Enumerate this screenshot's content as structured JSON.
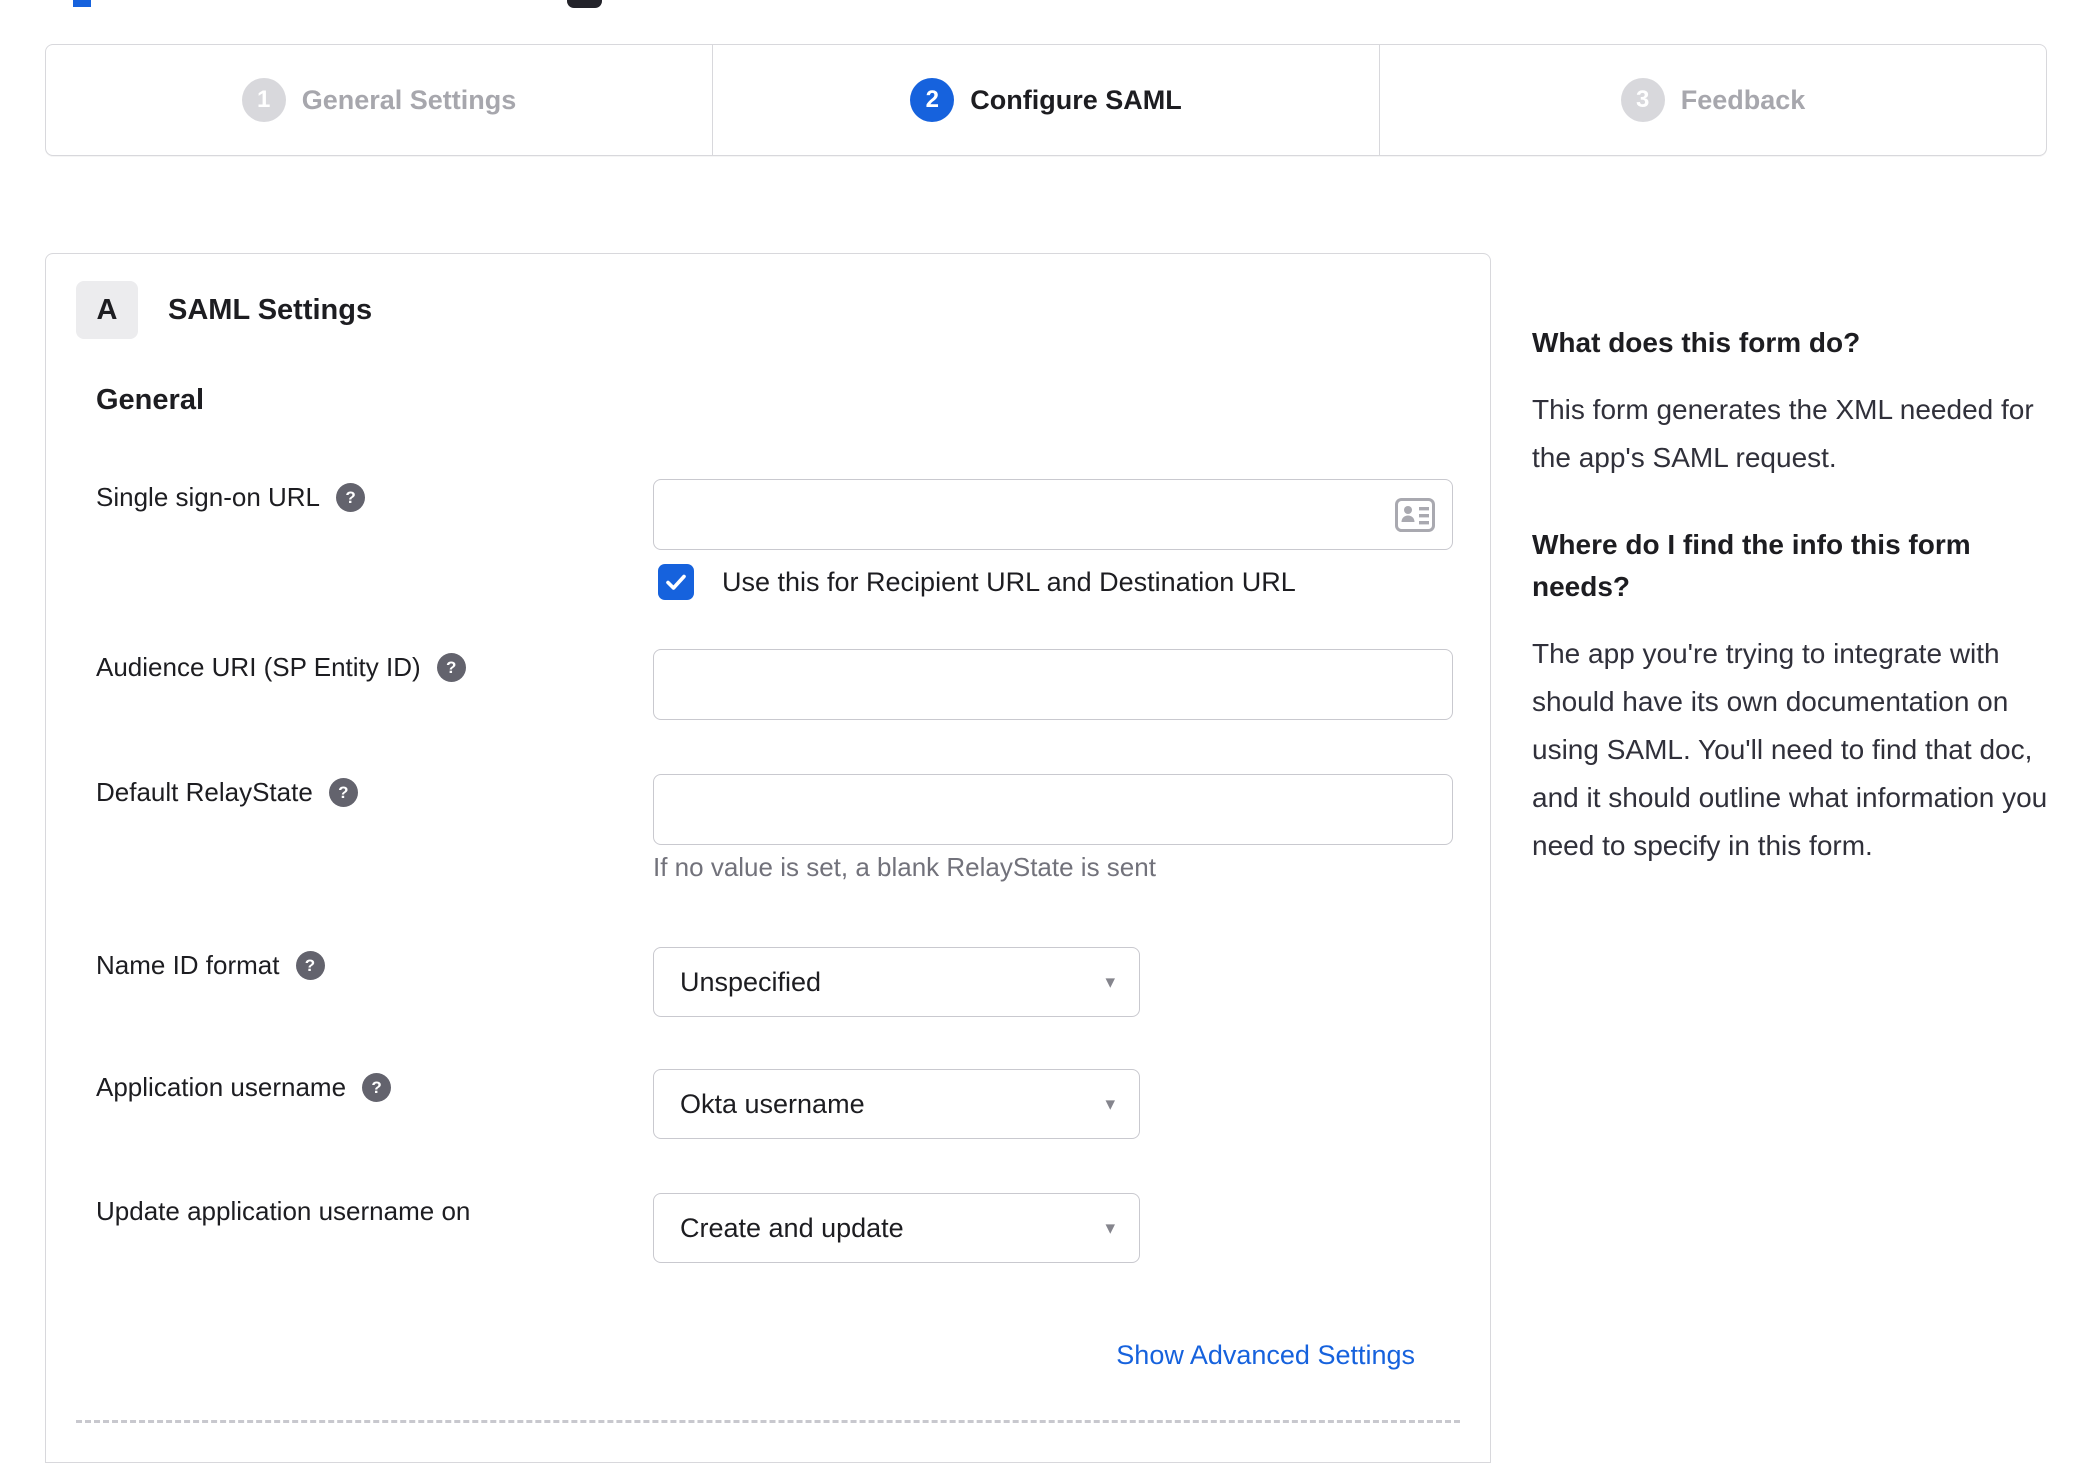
{
  "colors": {
    "accent_blue": "#1662dd",
    "inactive_gray": "#d8d8dc",
    "border": "#d8d8dc"
  },
  "header_fragments": {
    "blue_logo_fragment": "",
    "dark_control_fragment": ""
  },
  "stepper": {
    "steps": [
      {
        "number": "1",
        "label": "General Settings",
        "state": "inactive"
      },
      {
        "number": "2",
        "label": "Configure SAML",
        "state": "active"
      },
      {
        "number": "3",
        "label": "Feedback",
        "state": "inactive"
      }
    ]
  },
  "panel": {
    "section_letter": "A",
    "section_title": "SAML Settings",
    "group_title": "General",
    "help_icon_glyph": "?",
    "fields": {
      "sso": {
        "label": "Single sign-on URL",
        "value": "",
        "checkbox_checked": true,
        "checkbox_label": "Use this for Recipient URL and Destination URL"
      },
      "audience": {
        "label": "Audience URI (SP Entity ID)",
        "value": ""
      },
      "relay": {
        "label": "Default RelayState",
        "value": "",
        "hint": "If no value is set, a blank RelayState is sent"
      },
      "nameid": {
        "label": "Name ID format",
        "value": "Unspecified"
      },
      "appuser": {
        "label": "Application username",
        "value": "Okta username"
      },
      "updateuser": {
        "label": "Update application username on",
        "value": "Create and update"
      }
    },
    "advanced_link": "Show Advanced Settings"
  },
  "sidebar": {
    "q1": "What does this form do?",
    "a1": "This form generates the XML needed for the app's SAML request.",
    "q2": "Where do I find the info this form needs?",
    "a2": "The app you're trying to integrate with should have its own documentation on using SAML. You'll need to find that doc, and it should outline what information you need to specify in this form."
  }
}
